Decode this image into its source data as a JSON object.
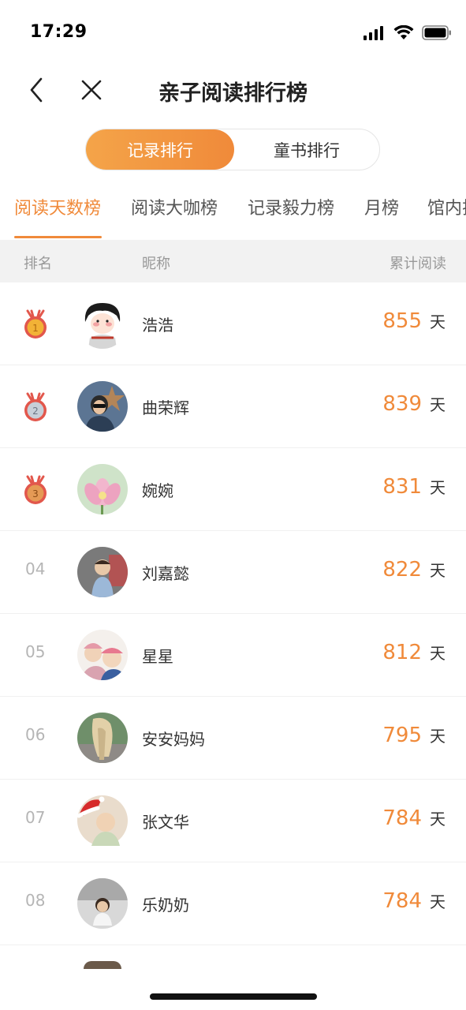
{
  "status": {
    "time": "17:29"
  },
  "nav": {
    "title": "亲子阅读排行榜",
    "back_icon": "chevron-left-icon",
    "close_icon": "close-icon"
  },
  "segment": {
    "active": "记录排行",
    "inactive": "童书排行"
  },
  "tabs": [
    "阅读天数榜",
    "阅读大咖榜",
    "记录毅力榜",
    "月榜",
    "馆内排"
  ],
  "active_tab": "阅读天数榜",
  "table_header": {
    "rank": "排名",
    "nickname": "昵称",
    "total": "累计阅读"
  },
  "rows": [
    {
      "rank": "1",
      "medal": "gold",
      "name": "浩浩",
      "days": "855",
      "unit": "天",
      "avatar_color": "#2a2a2a"
    },
    {
      "rank": "2",
      "medal": "silver",
      "name": "曲荣辉",
      "days": "839",
      "unit": "天",
      "avatar_color": "#3e5a7a"
    },
    {
      "rank": "3",
      "medal": "bronze",
      "name": "婉婉",
      "days": "831",
      "unit": "天",
      "avatar_color": "#e7b4c8"
    },
    {
      "rank": "04",
      "medal": "",
      "name": "刘嘉懿",
      "days": "822",
      "unit": "天",
      "avatar_color": "#6b6b6b"
    },
    {
      "rank": "05",
      "medal": "",
      "name": "星星",
      "days": "812",
      "unit": "天",
      "avatar_color": "#e8a8b0"
    },
    {
      "rank": "06",
      "medal": "",
      "name": "安安妈妈",
      "days": "795",
      "unit": "天",
      "avatar_color": "#8a9a7a"
    },
    {
      "rank": "07",
      "medal": "",
      "name": "张文华",
      "days": "784",
      "unit": "天",
      "avatar_color": "#d9c2a8"
    },
    {
      "rank": "08",
      "medal": "",
      "name": "乐奶奶",
      "days": "784",
      "unit": "天",
      "avatar_color": "#bdbdbd"
    }
  ],
  "colors": {
    "accent": "#f08a3a",
    "gold": "#f2b236",
    "silver": "#c7cfd8",
    "bronze": "#e59a55",
    "medal_ribbon": "#e2574c"
  }
}
